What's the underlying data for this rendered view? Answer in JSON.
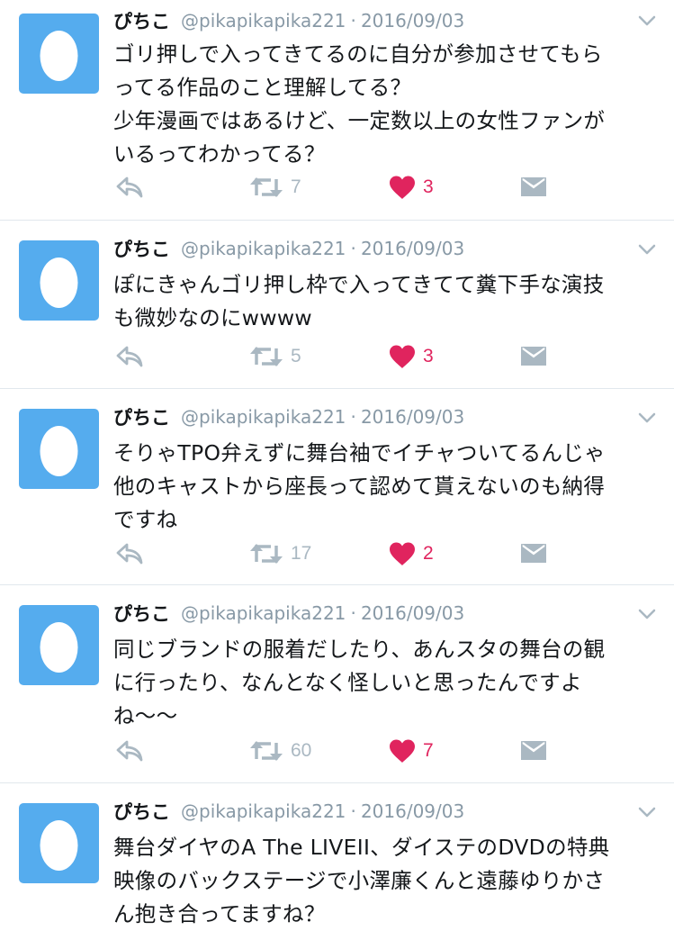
{
  "tweets": [
    {
      "name": "ぴちこ",
      "handle": "@pikapikapika221",
      "separator": "·",
      "date": "2016/09/03",
      "text": "ゴリ押しで入ってきてるのに自分が参加させてもら\nってる作品のこと理解してる？\n少年漫画ではあるけど、一定数以上の女性ファンが\nいるってわかってる？",
      "retweets": "7",
      "likes": "3"
    },
    {
      "name": "ぴちこ",
      "handle": "@pikapikapika221",
      "separator": "·",
      "date": "2016/09/03",
      "text": "ぽにきゃんゴリ押し枠で入ってきてて糞下手な演技\nも微妙なのにwwww",
      "retweets": "5",
      "likes": "3"
    },
    {
      "name": "ぴちこ",
      "handle": "@pikapikapika221",
      "separator": "·",
      "date": "2016/09/03",
      "text": "そりゃTPO弁えずに舞台袖でイチャついてるんじゃ\n他のキャストから座長って認めて貰えないのも納得\nですね",
      "retweets": "17",
      "likes": "2"
    },
    {
      "name": "ぴちこ",
      "handle": "@pikapikapika221",
      "separator": "·",
      "date": "2016/09/03",
      "text": "同じブランドの服着だしたり、あんスタの舞台の観\nに行ったり、なんとなく怪しいと思ったんですよ\nね〜〜",
      "retweets": "60",
      "likes": "7"
    },
    {
      "name": "ぴちこ",
      "handle": "@pikapikapika221",
      "separator": "·",
      "date": "2016/09/03",
      "text": "舞台ダイヤのA The LIVEII、ダイステのDVDの特典\n映像のバックステージで小澤廉くんと遠藤ゆりかさ\nん抱き合ってますね？"
    }
  ],
  "colors": {
    "avatar_bg": "#55acee",
    "icon_gray": "#aab8c2",
    "like_red": "#e0245e",
    "meta_gray": "#8899a6",
    "divider": "#e1e8ed"
  },
  "icons": [
    "egg-avatar-icon",
    "caret-down-icon",
    "reply-icon",
    "retweet-icon",
    "heart-icon",
    "direct-message-icon"
  ]
}
